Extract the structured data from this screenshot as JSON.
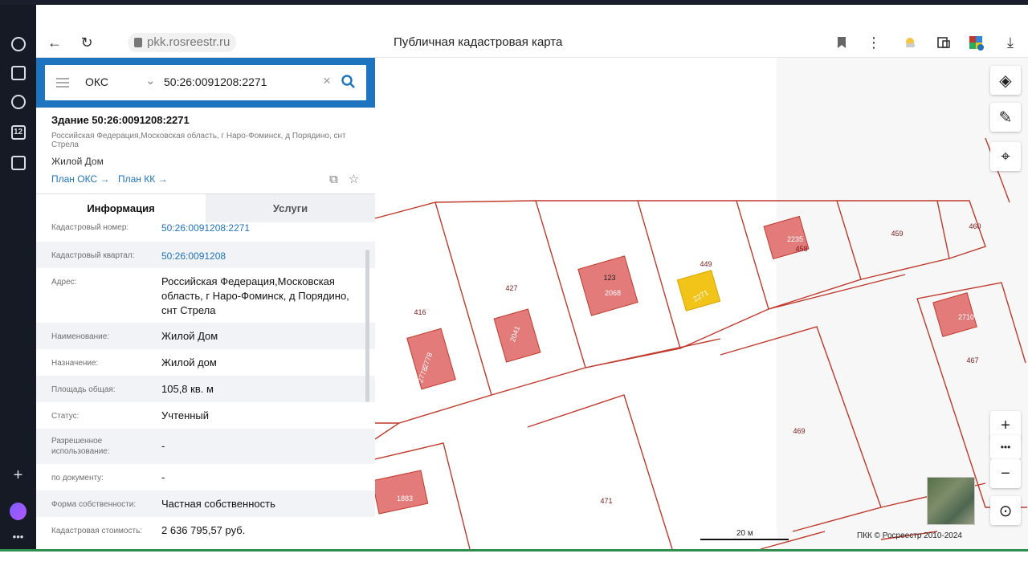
{
  "browser": {
    "url": "pkk.rosreestr.ru",
    "title": "Публичная кадастровая карта"
  },
  "search": {
    "type": "ОКС",
    "query": "50:26:0091208:2271"
  },
  "object": {
    "title": "Здание 50:26:0091208:2271",
    "address": "Российская Федерация,Московская область, г Наро-Фоминск, д Порядино, снт Стрела",
    "name": "Жилой Дом",
    "plan_oks": "План ОКС →",
    "plan_kk": "План КК →"
  },
  "tabs": [
    "Информация",
    "Услуги"
  ],
  "rows": [
    {
      "label": "Кадастровый номер:",
      "value": "50:26:0091208:2271",
      "link": true
    },
    {
      "label": "Кадастровый квартал:",
      "value": "50:26:0091208",
      "link": true
    },
    {
      "label": "Адрес:",
      "value": "Российская Федерация,Московская область, г Наро-Фоминск, д Порядино, снт Стрела",
      "link": false
    },
    {
      "label": "Наименование:",
      "value": "Жилой Дом",
      "link": false
    },
    {
      "label": "Назначение:",
      "value": "Жилой дом",
      "link": false
    },
    {
      "label": "Площадь общая:",
      "value": "105,8 кв. м",
      "link": false
    },
    {
      "label": "Статус:",
      "value": "Учтенный",
      "link": false
    },
    {
      "label": "Разрешенное использование:",
      "value": "-",
      "link": false
    },
    {
      "label": "по документу:",
      "value": "-",
      "link": false
    },
    {
      "label": "Форма собственности:",
      "value": "Частная собственность",
      "link": false
    },
    {
      "label": "Кадастровая стоимость:",
      "value": "2 636 795,57 руб.",
      "link": false
    }
  ],
  "map": {
    "scale": "20 м",
    "copyright": "ПКК © Росреестр 2010-2024",
    "parcels": [
      "416",
      "427",
      "449",
      "458",
      "459",
      "460",
      "467",
      "469",
      "471"
    ],
    "buildings": [
      "2778",
      "2778",
      "2041",
      "123",
      "2068",
      "2271",
      "2235",
      "2710",
      "1883"
    ],
    "colors": {
      "boundary": "#c0392b",
      "building": "#e37b7b",
      "selected": "#f2c318"
    }
  }
}
